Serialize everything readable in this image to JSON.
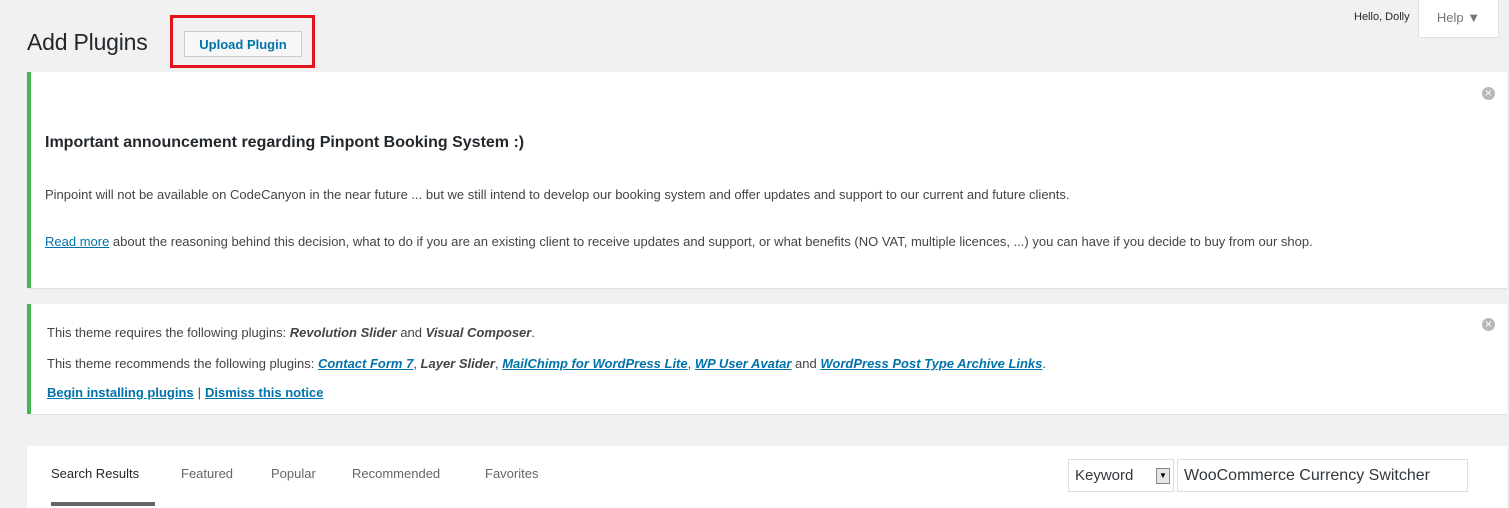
{
  "header": {
    "title": "Add Plugins",
    "upload_label": "Upload Plugin",
    "greeting": "Hello, Dolly",
    "help_label": "Help ▼"
  },
  "notice_announcement": {
    "heading": "Important announcement regarding Pinpont Booking System :)",
    "paragraph1": "Pinpoint will not be available on CodeCanyon in the near future ... but we still intend to develop our booking system and offer updates and support to our current and future clients.",
    "read_more_link": "Read more",
    "paragraph2_rest": " about the reasoning behind this decision, what to do if you are an existing client to receive updates and support, or what benefits (NO VAT, multiple licences, ...) you can have if you decide to buy from our shop.",
    "dismiss_icon": "⨯"
  },
  "notice_plugins": {
    "requires_text": "This theme requires the following plugins: ",
    "req1": "Revolution Slider",
    "and1": " and ",
    "req2": "Visual Composer",
    "period1": ".",
    "recommends_text": "This theme recommends the following plugins: ",
    "rec1": "Contact Form 7",
    "comma1": ", ",
    "rec2": "Layer Slider",
    "comma2": ", ",
    "rec3": "MailChimp for WordPress Lite",
    "comma3": ", ",
    "rec4": "WP User Avatar",
    "and2": " and ",
    "rec5": "WordPress Post Type Archive Links",
    "period2": ".",
    "begin_link": "Begin installing plugins",
    "separator": "|",
    "dismiss_link": "Dismiss this notice",
    "dismiss_icon": "⨯"
  },
  "filter": {
    "tabs": [
      "Search Results",
      "Featured",
      "Popular",
      "Recommended",
      "Favorites"
    ],
    "search_type": "Keyword",
    "search_value": "WooCommerce Currency Switcher"
  },
  "colors": {
    "accent_link": "#0073aa",
    "notice_border": "#46b450",
    "highlight_box": "#e4141d"
  }
}
